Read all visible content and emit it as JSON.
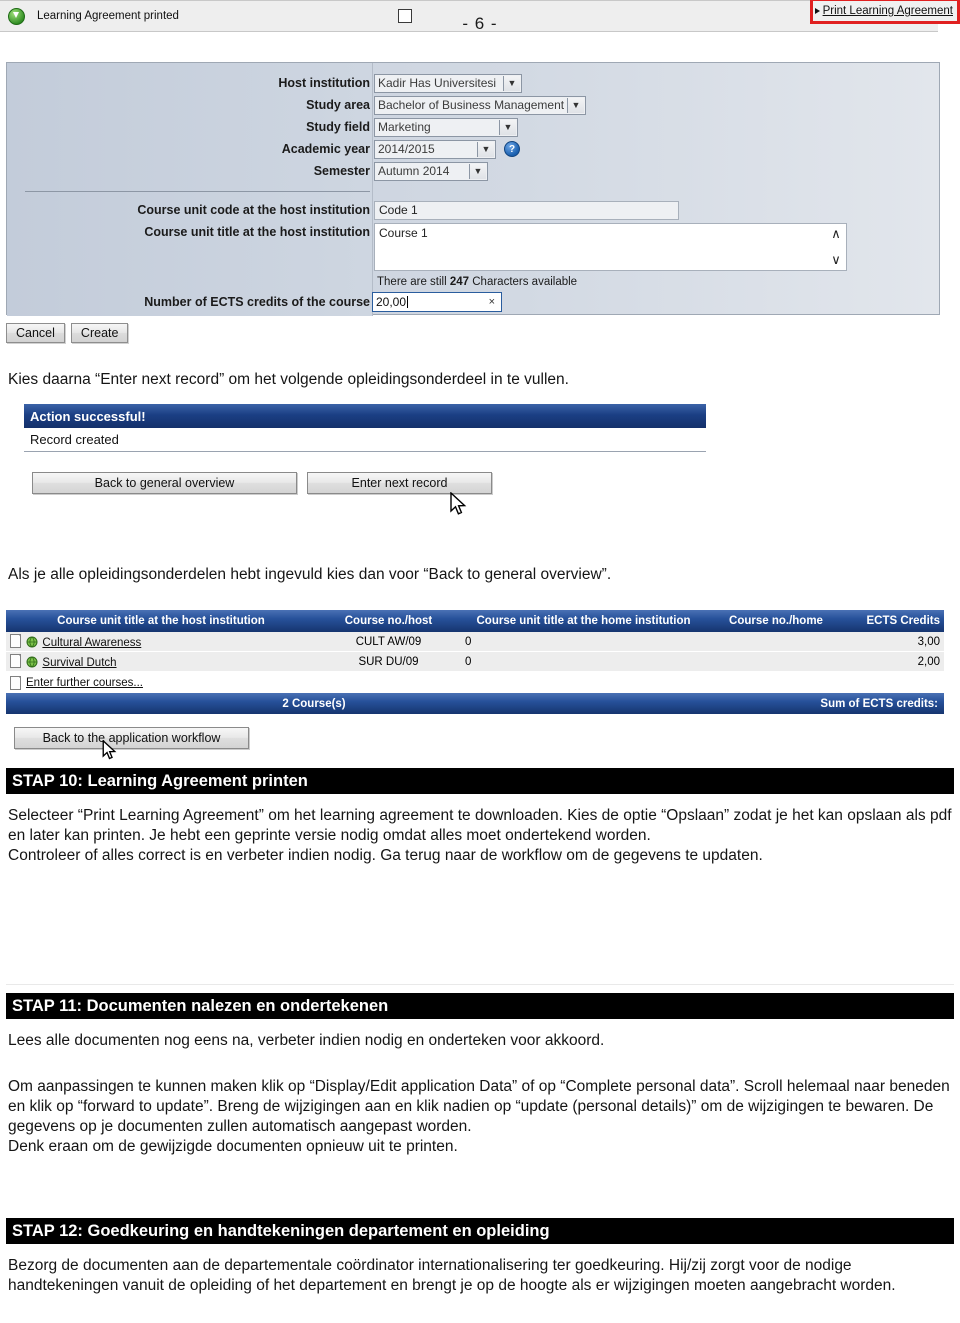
{
  "page": {
    "number_label": "- 6 -"
  },
  "form": {
    "fields": [
      {
        "label": "Host institution",
        "value": "Kadir Has Universitesi",
        "type": "select"
      },
      {
        "label": "Study area",
        "value": "Bachelor of Business Management",
        "type": "select"
      },
      {
        "label": "Study field",
        "value": "Marketing",
        "type": "select"
      },
      {
        "label": "Academic year",
        "value": "2014/2015",
        "type": "select"
      },
      {
        "label": "Semester",
        "value": "Autumn 2014",
        "type": "select"
      }
    ],
    "help_icon_glyph": "?",
    "course_code": {
      "label": "Course unit code at the host institution",
      "value": "Code 1"
    },
    "course_title": {
      "label": "Course unit title at the host institution",
      "value": "Course 1"
    },
    "char_counter": {
      "prefix": "There are still ",
      "count": "247",
      "suffix": " Characters available"
    },
    "ects": {
      "label": "Number of ECTS credits of the course",
      "value": "20,00",
      "clear_glyph": "×"
    },
    "buttons": {
      "cancel": "Cancel",
      "create": "Create"
    },
    "dropdown_arrow_glyph": "⌄",
    "scroll_up_glyph": "∧",
    "scroll_down_glyph": "∨"
  },
  "paragraphs": {
    "p1": "Kies daarna “Enter next record” om het volgende opleidingsonderdeel in te vullen.",
    "p2": "Als je alle opleidingsonderdelen hebt ingevuld kies dan voor “Back to general overview”."
  },
  "action_panel": {
    "title": "Action successful!",
    "message": "Record created",
    "buttons": {
      "back": "Back to general overview",
      "next": "Enter next record"
    }
  },
  "course_table": {
    "headers": [
      "Course unit title at the host institution",
      "Course no./host",
      "Course unit title at the home institution",
      "Course no./home",
      "ECTS Credits"
    ],
    "rows": [
      {
        "title_host": "Cultural Awareness",
        "no_host": "CULT AW/09",
        "title_home": "0",
        "no_home": "",
        "ects": "3,00"
      },
      {
        "title_host": "Survival Dutch",
        "no_host": "SUR DU/09",
        "title_home": "0",
        "no_home": "",
        "ects": "2,00"
      }
    ],
    "further_link": "Enter further courses...",
    "footer": {
      "count": "2 Course(s)",
      "sum_label": "Sum of ECTS credits:",
      "sum_value": ""
    },
    "back_button": "Back to the application workflow"
  },
  "stap10": {
    "heading": "STAP 10: Learning Agreement printen",
    "body": "Selecteer “Print Learning Agreement” om het learning agreement te downloaden. Kies de optie “Opslaan” zodat je het kan opslaan als pdf en later kan printen. Je hebt een geprinte versie nodig omdat alles moet ondertekend worden.\nControleer of alles correct is en verbeter indien nodig. Ga terug naar de workflow om de gegevens te updaten."
  },
  "print_bar": {
    "status_label": "Learning Agreement printed",
    "link_label": "Print Learning Agreement",
    "checkbox_checked": false
  },
  "stap11": {
    "heading": "STAP 11: Documenten nalezen en ondertekenen",
    "body1": "Lees alle documenten nog eens na, verbeter indien nodig en onderteken voor akkoord.",
    "body2": "Om aanpassingen te kunnen maken klik op “Display/Edit application Data” of op “Complete personal data”. Scroll helemaal naar beneden en klik op “forward to update”. Breng de wijzigingen aan en klik nadien op “update (personal details)” om de wijzigingen te bewaren. De gegevens op je documenten zullen automatisch aangepast worden.\nDenk eraan om de gewijzigde documenten opnieuw uit te printen."
  },
  "stap12": {
    "heading": "STAP 12: Goedkeuring en handtekeningen departement en opleiding",
    "body": "Bezorg de documenten aan de departementale coördinator internationalisering ter goedkeuring. Hij/zij zorgt voor de nodige handtekeningen vanuit de opleiding of het departement en brengt je op de hoogte als er wijzigingen moeten aangebracht worden."
  },
  "colors": {
    "accent_blue": "#1b3f84",
    "stap_bar": "#000000",
    "highlight_red": "#e02020",
    "green": "#2e8b21"
  }
}
